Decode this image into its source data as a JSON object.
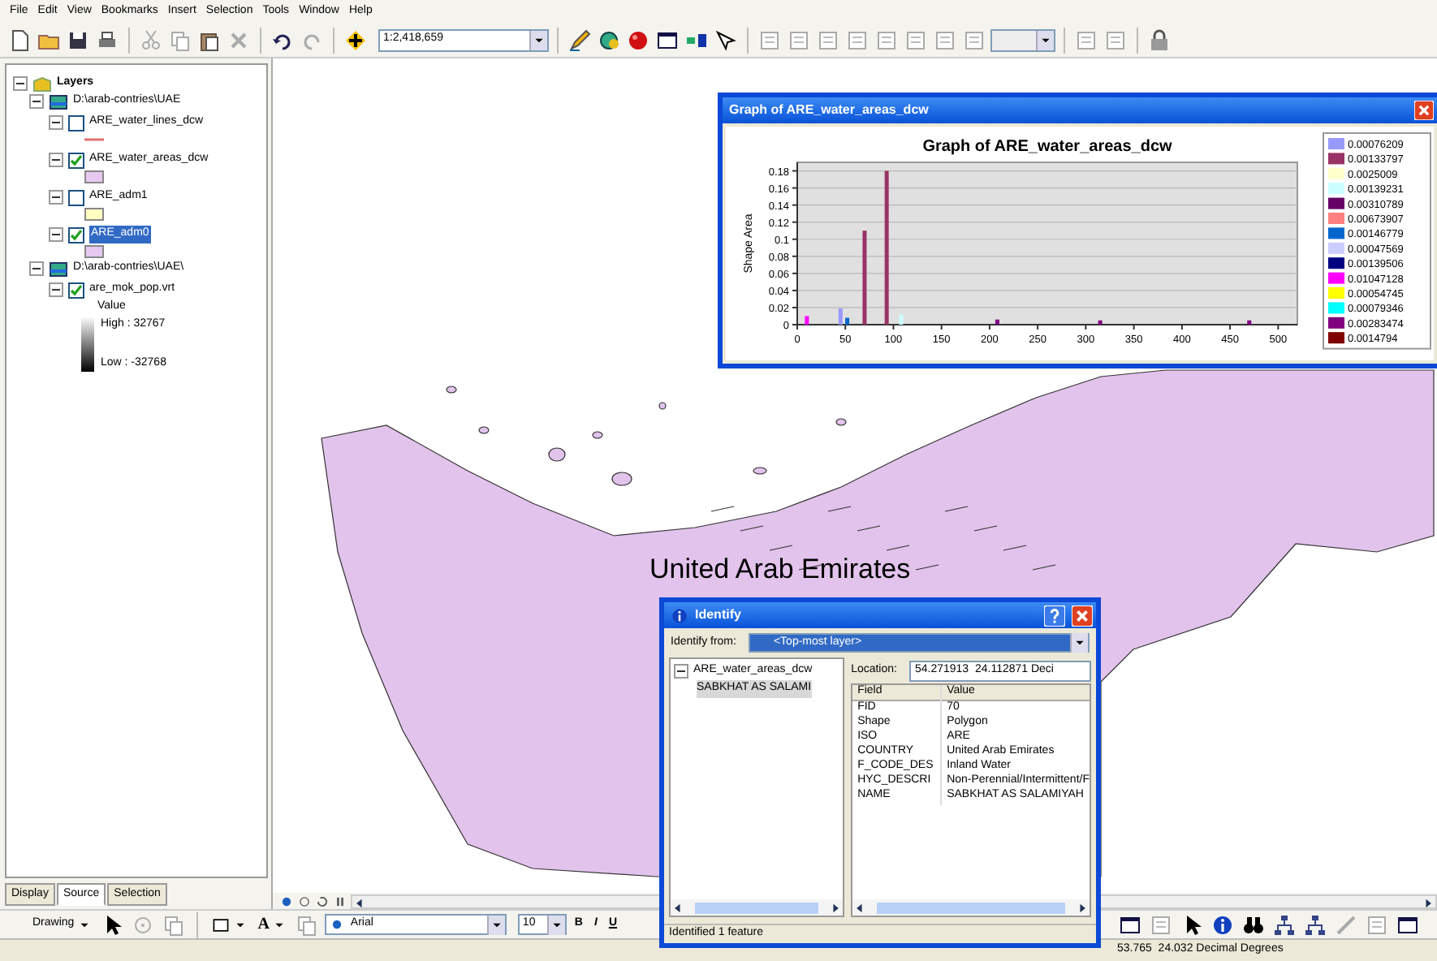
{
  "menu": [
    "File",
    "Edit",
    "View",
    "Bookmarks",
    "Insert",
    "Selection",
    "Tools",
    "Window",
    "Help"
  ],
  "toolbar": {
    "scale": "1:2,418,659"
  },
  "toc": {
    "root": {
      "label": "Layers",
      "expanded": true
    },
    "groups": [
      {
        "label": "D:\\arab-contries\\UAE",
        "expanded": true,
        "layers": [
          {
            "name": "ARE_water_lines_dcw",
            "expanded": true,
            "checked": false,
            "selected": false,
            "symbol": {
              "kind": "line",
              "color": "#e07070"
            }
          },
          {
            "name": "ARE_water_areas_dcw",
            "expanded": true,
            "checked": true,
            "selected": false,
            "symbol": {
              "kind": "fill",
              "color": "#e6c8f0"
            }
          },
          {
            "name": "ARE_adm1",
            "expanded": true,
            "checked": false,
            "selected": false,
            "symbol": {
              "kind": "fill",
              "color": "#ffffc0"
            }
          },
          {
            "name": "ARE_adm0",
            "expanded": true,
            "checked": true,
            "selected": true,
            "symbol": {
              "kind": "fill",
              "color": "#e6c8f0"
            }
          }
        ]
      },
      {
        "label": "D:\\arab-contries\\UAE\\",
        "expanded": true,
        "layers": [
          {
            "name": "are_mok_pop.vrt",
            "expanded": true,
            "checked": true,
            "selected": false,
            "symbol": {
              "kind": "ramp",
              "field": "Value",
              "high": "High : 32767",
              "low": "Low : -32768"
            }
          }
        ]
      }
    ],
    "tabs": [
      {
        "label": "Display",
        "selected": false
      },
      {
        "label": "Source",
        "selected": true
      },
      {
        "label": "Selection",
        "selected": false
      }
    ]
  },
  "map": {
    "label": "United Arab Emirates"
  },
  "graph_window": {
    "title": "Graph of ARE_water_areas_dcw",
    "chart_data": {
      "type": "bar",
      "title": "Graph of ARE_water_areas_dcw",
      "ylabel": "Shape Area",
      "x": [
        10,
        45,
        52,
        70,
        93,
        108,
        208,
        315,
        470
      ],
      "grid": true,
      "legend": true,
      "xlim": [
        0,
        520
      ],
      "ylim": [
        0,
        0.19
      ],
      "xticks": [
        0,
        50,
        100,
        150,
        200,
        250,
        300,
        350,
        400,
        450,
        500
      ],
      "yticks": [
        0,
        0.02,
        0.04,
        0.06,
        0.08,
        0.1,
        0.12,
        0.14,
        0.16,
        0.18
      ],
      "series": [
        {
          "name": "0.00076209",
          "color": "#9999ff",
          "values": [
            null,
            0.019,
            null,
            null,
            null,
            null,
            null,
            null,
            null
          ]
        },
        {
          "name": "0.00133797",
          "color": "#993366",
          "values": [
            null,
            null,
            null,
            0.11,
            0.18,
            null,
            null,
            null,
            null
          ]
        },
        {
          "name": "0.0025009",
          "color": "#ffffcc",
          "values": [
            null,
            null,
            null,
            null,
            null,
            null,
            null,
            null,
            null
          ]
        },
        {
          "name": "0.00139231",
          "color": "#ccffff",
          "values": [
            null,
            null,
            null,
            null,
            null,
            0.012,
            null,
            null,
            null
          ]
        },
        {
          "name": "0.00310789",
          "color": "#660066",
          "values": [
            null,
            null,
            null,
            null,
            null,
            null,
            null,
            null,
            null
          ]
        },
        {
          "name": "0.00673907",
          "color": "#ff8080",
          "values": [
            null,
            null,
            null,
            null,
            null,
            null,
            null,
            null,
            null
          ]
        },
        {
          "name": "0.00146779",
          "color": "#0066cc",
          "values": [
            null,
            null,
            0.008,
            null,
            null,
            null,
            null,
            null,
            null
          ]
        },
        {
          "name": "0.00047569",
          "color": "#ccccff",
          "values": [
            null,
            null,
            null,
            null,
            null,
            null,
            null,
            null,
            null
          ]
        },
        {
          "name": "0.00139506",
          "color": "#000080",
          "values": [
            null,
            null,
            null,
            null,
            null,
            null,
            null,
            null,
            null
          ]
        },
        {
          "name": "0.01047128",
          "color": "#ff00ff",
          "values": [
            0.01,
            null,
            null,
            null,
            null,
            null,
            null,
            null,
            null
          ]
        },
        {
          "name": "0.00054745",
          "color": "#ffff00",
          "values": [
            null,
            null,
            null,
            null,
            null,
            null,
            null,
            null,
            null
          ]
        },
        {
          "name": "0.00079346",
          "color": "#00ffff",
          "values": [
            null,
            null,
            null,
            null,
            null,
            null,
            null,
            null,
            null
          ]
        },
        {
          "name": "0.00283474",
          "color": "#800080",
          "values": [
            null,
            null,
            null,
            null,
            null,
            null,
            0.006,
            0.005,
            0.005
          ]
        },
        {
          "name": "0.0014794",
          "color": "#800000",
          "values": [
            null,
            null,
            null,
            null,
            null,
            null,
            null,
            null,
            null
          ]
        }
      ]
    }
  },
  "identify_window": {
    "title": "Identify",
    "from_label": "Identify from:",
    "from_value": "<Top-most layer>",
    "tree": [
      {
        "label": "ARE_water_areas_dcw",
        "expanded": true,
        "children": [
          {
            "label": "SABKHAT AS SALAMI",
            "selected": true
          }
        ]
      }
    ],
    "location_label": "Location:",
    "location": "54.271913  24.112871 Deci",
    "columns": [
      "Field",
      "Value"
    ],
    "rows": [
      [
        "FID",
        "70"
      ],
      [
        "Shape",
        "Polygon"
      ],
      [
        "ISO",
        "ARE"
      ],
      [
        "COUNTRY",
        "United Arab Emirates"
      ],
      [
        "F_CODE_DES",
        "Inland Water"
      ],
      [
        "HYC_DESCRI",
        "Non-Perennial/Intermittent/F"
      ],
      [
        "NAME",
        "SABKHAT AS SALAMIYAH"
      ]
    ],
    "status": "Identified 1 feature"
  },
  "drawing_toolbar": {
    "menu": "Drawing",
    "text_tool": "A",
    "font": "Arial",
    "size": "10",
    "styles": [
      "B",
      "I",
      "U"
    ]
  },
  "status_bar": {
    "coordinates": "53.765  24.032 Decimal Degrees"
  }
}
